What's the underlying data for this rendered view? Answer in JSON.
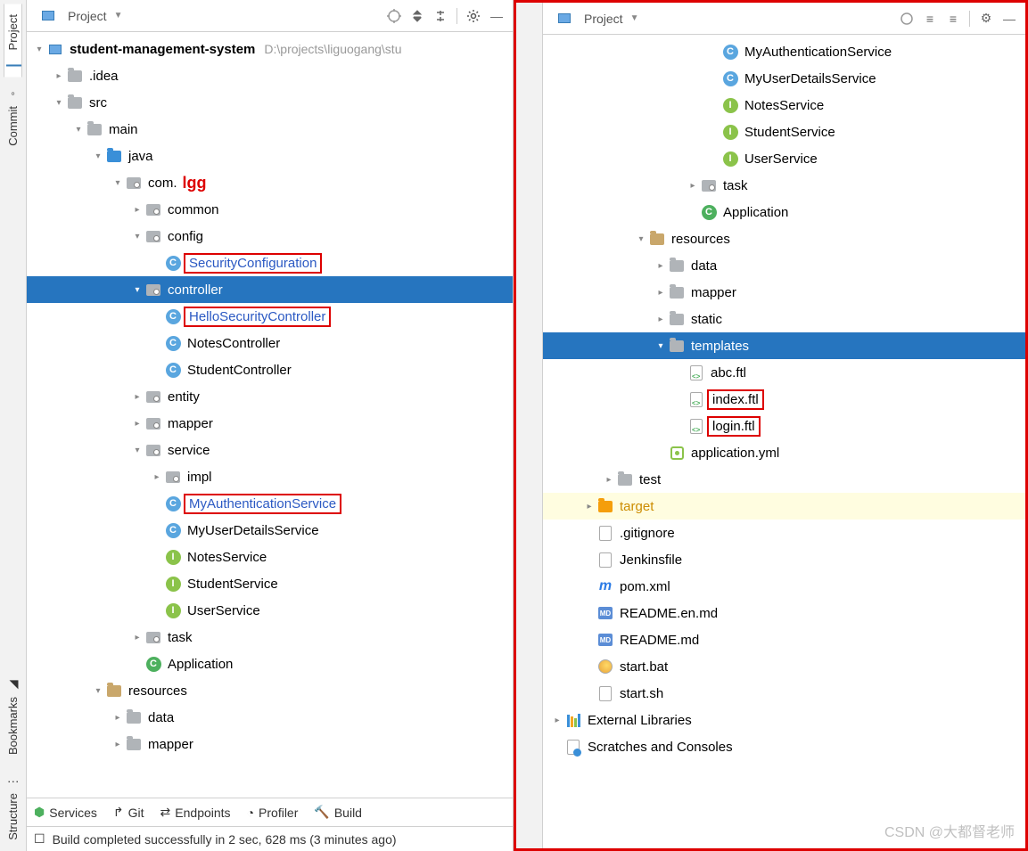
{
  "left": {
    "sidebarTabs": [
      "Project",
      "Commit",
      "Bookmarks",
      "Structure"
    ],
    "header": {
      "title": "Project"
    },
    "root": {
      "name": "student-management-system",
      "path": "D:\\projects\\liguogang\\stu"
    },
    "idea": ".idea",
    "src": "src",
    "main": "main",
    "java": "java",
    "pkg": "com.",
    "pkgAnnot": "lgg",
    "common": "common",
    "config": "config",
    "securityConfig": "SecurityConfiguration",
    "controller": "controller",
    "helloSec": "HelloSecurityController",
    "notesCtrl": "NotesController",
    "studentCtrl": "StudentController",
    "entity": "entity",
    "mapper": "mapper",
    "service": "service",
    "impl": "impl",
    "myAuth": "MyAuthenticationService",
    "myUser": "MyUserDetailsService",
    "notesSvc": "NotesService",
    "studentSvc": "StudentService",
    "userSvc": "UserService",
    "task": "task",
    "app": "Application",
    "resources": "resources",
    "data": "data",
    "mapper2": "mapper",
    "footerTabs": [
      "Services",
      "Git",
      "Endpoints",
      "Profiler",
      "Build"
    ],
    "status": "Build completed successfully in 2 sec, 628 ms (3 minutes ago)"
  },
  "right": {
    "header": {
      "title": "Project"
    },
    "myAuth": "MyAuthenticationService",
    "myUser": "MyUserDetailsService",
    "notesSvc": "NotesService",
    "studentSvc": "StudentService",
    "userSvc": "UserService",
    "task": "task",
    "app": "Application",
    "resources": "resources",
    "data": "data",
    "mapper": "mapper",
    "static": "static",
    "templates": "templates",
    "abc": "abc.ftl",
    "index": "index.ftl",
    "login": "login.ftl",
    "yml": "application.yml",
    "test": "test",
    "target": "target",
    "gitignore": ".gitignore",
    "jenkins": "Jenkinsfile",
    "pom": "pom.xml",
    "readmeEn": "README.en.md",
    "readme": "README.md",
    "startBat": "start.bat",
    "startSh": "start.sh",
    "extLib": "External Libraries",
    "scratches": "Scratches and Consoles",
    "watermark": "CSDN @大都督老师"
  }
}
